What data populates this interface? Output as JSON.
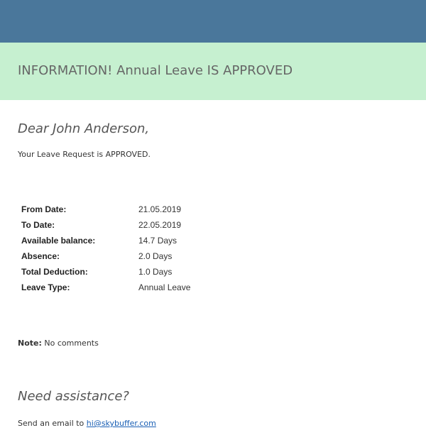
{
  "banner": {
    "text": "INFORMATION! Annual Leave IS APPROVED"
  },
  "greeting": "Dear John Anderson,",
  "intro": "Your Leave Request is APPROVED.",
  "details": [
    {
      "label": "From Date:",
      "value": "21.05.2019"
    },
    {
      "label": "To Date:",
      "value": "22.05.2019"
    },
    {
      "label": "Available balance:",
      "value": "14.7 Days"
    },
    {
      "label": "Absence:",
      "value": "2.0 Days"
    },
    {
      "label": "Total Deduction:",
      "value": "1.0 Days"
    },
    {
      "label": "Leave Type:",
      "value": "Annual Leave"
    }
  ],
  "note": {
    "label": "Note:",
    "text": " No comments"
  },
  "assistance": {
    "heading": "Need assistance?",
    "prefix": "Send an email to ",
    "email": "hi@skybuffer.com"
  },
  "colors": {
    "header_bar": "#4a779b",
    "banner_bg": "#c6f0d0",
    "link": "#1a5fb4"
  }
}
